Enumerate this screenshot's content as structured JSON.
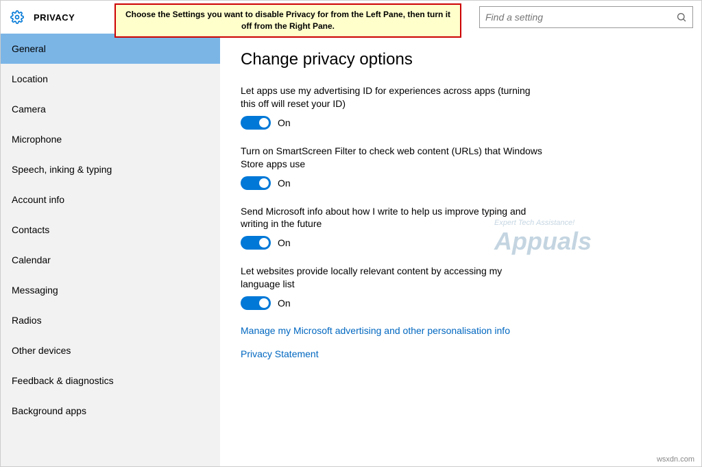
{
  "header": {
    "title": "PRIVACY",
    "search_placeholder": "Find a setting"
  },
  "callout": {
    "text": "Choose the Settings you want to disable Privacy for from the Left Pane, then turn it off from the Right Pane."
  },
  "sidebar": {
    "items": [
      {
        "label": "General",
        "selected": true
      },
      {
        "label": "Location"
      },
      {
        "label": "Camera"
      },
      {
        "label": "Microphone"
      },
      {
        "label": "Speech, inking & typing"
      },
      {
        "label": "Account info"
      },
      {
        "label": "Contacts"
      },
      {
        "label": "Calendar"
      },
      {
        "label": "Messaging"
      },
      {
        "label": "Radios"
      },
      {
        "label": "Other devices"
      },
      {
        "label": "Feedback & diagnostics"
      },
      {
        "label": "Background apps"
      }
    ]
  },
  "main": {
    "heading": "Change privacy options",
    "options": [
      {
        "desc": "Let apps use my advertising ID for experiences across apps (turning this off will reset your ID)",
        "state": "On"
      },
      {
        "desc": "Turn on SmartScreen Filter to check web content (URLs) that Windows Store apps use",
        "state": "On"
      },
      {
        "desc": "Send Microsoft info about how I write to help us improve typing and writing in the future",
        "state": "On"
      },
      {
        "desc": "Let websites provide locally relevant content by accessing my language list",
        "state": "On"
      }
    ],
    "links": [
      "Manage my Microsoft advertising and other personalisation info",
      "Privacy Statement"
    ]
  },
  "watermark": {
    "line1": "Expert Tech Assistance!",
    "line2": "Appuals"
  },
  "attribution": "wsxdn.com"
}
